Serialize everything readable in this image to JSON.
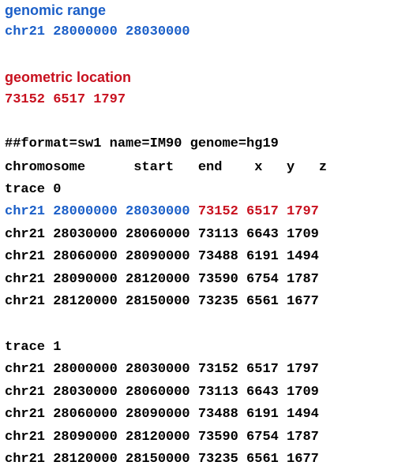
{
  "colors": {
    "genomic": "#1b5fc8",
    "geometric": "#c8111f",
    "text": "#000000"
  },
  "genomic_range": {
    "heading": "genomic range",
    "value": "chr21 28000000 28030000"
  },
  "geometric_location": {
    "heading": "geometric location",
    "value": "73152 6517 1797"
  },
  "file": {
    "format_line": "##format=sw1 name=IM90 genome=hg19",
    "columns_line": "chromosome      start   end    x   y   z",
    "trace0": {
      "label": "trace 0",
      "highlight_row": {
        "genomic": "chr21 28000000 28030000",
        "geometric": "73152 6517 1797"
      },
      "rows": [
        "chr21 28030000 28060000 73113 6643 1709",
        "chr21 28060000 28090000 73488 6191 1494",
        "chr21 28090000 28120000 73590 6754 1787",
        "chr21 28120000 28150000 73235 6561 1677"
      ]
    },
    "trace1": {
      "label": "trace 1",
      "rows": [
        "chr21 28000000 28030000 73152 6517 1797",
        "chr21 28030000 28060000 73113 6643 1709",
        "chr21 28060000 28090000 73488 6191 1494",
        "chr21 28090000 28120000 73590 6754 1787",
        "chr21 28120000 28150000 73235 6561 1677"
      ]
    }
  }
}
